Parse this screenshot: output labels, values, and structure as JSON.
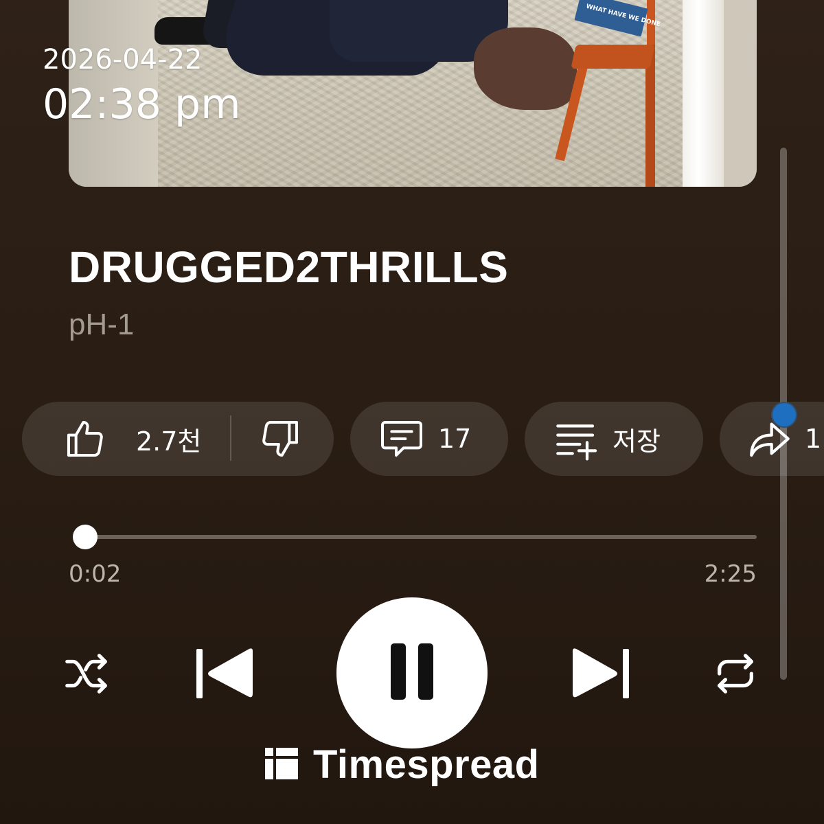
{
  "status": {
    "date": "2026-04-22",
    "time": "02:38 pm"
  },
  "album_art": {
    "book_title": "WHAT HAVE WE DONE"
  },
  "track": {
    "title": "DRUGGED2THRILLS",
    "artist": "pH-1"
  },
  "actions": {
    "like_count": "2.7천",
    "comment_count": "17",
    "save_label": "저장",
    "share_label": "1"
  },
  "playback": {
    "elapsed": "0:02",
    "total": "2:25",
    "progress": 0.014,
    "state": "playing"
  },
  "scroll": {
    "position_fraction": 0.48
  },
  "watermark": {
    "text": "Timespread"
  },
  "colors": {
    "background": "#2a1e14",
    "accent": "#ffffff",
    "scroll_thumb": "#1e6fbf"
  }
}
